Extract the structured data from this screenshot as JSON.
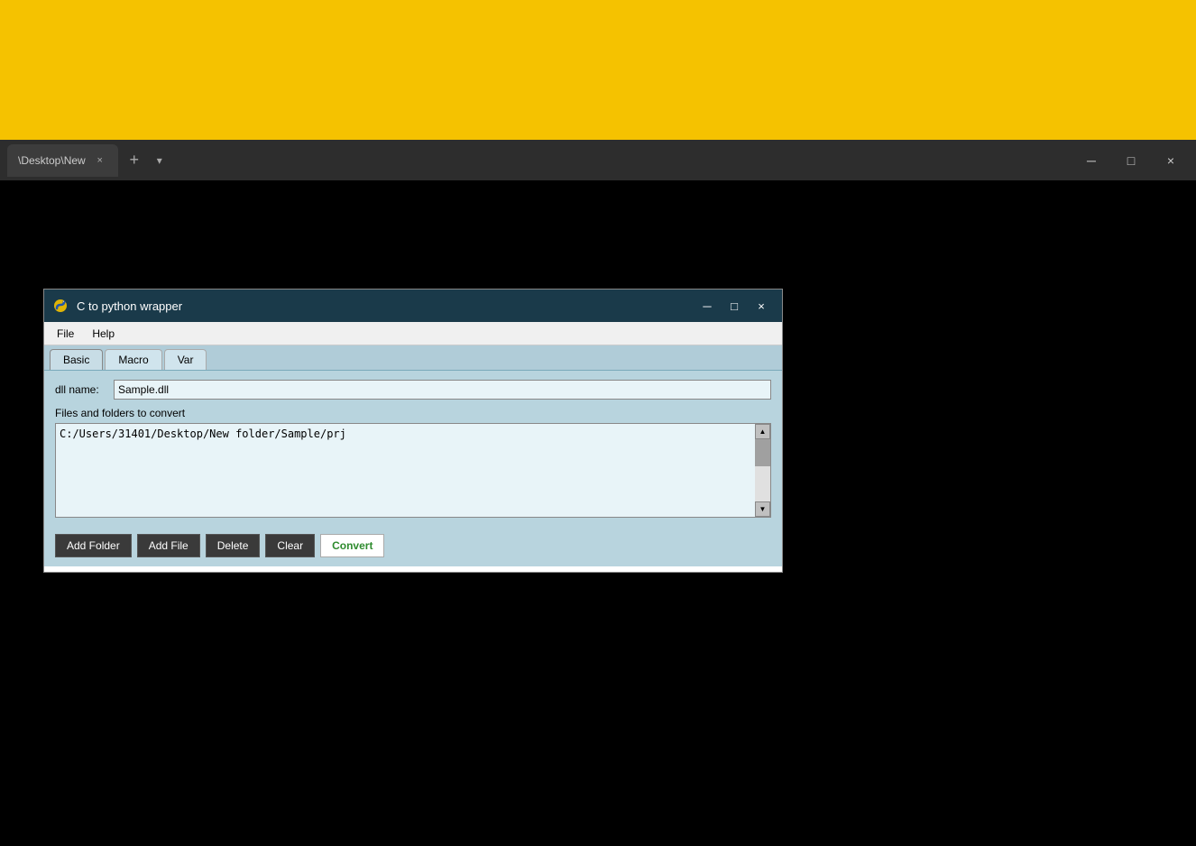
{
  "topbar": {
    "background_color": "#F5C200"
  },
  "browser_chrome": {
    "tab_label": "\\Desktop\\New",
    "tab_close_symbol": "×",
    "new_tab_symbol": "+",
    "dropdown_symbol": "▾",
    "minimize_symbol": "─",
    "maximize_symbol": "□",
    "close_symbol": "×"
  },
  "app_window": {
    "title": "C to python wrapper",
    "title_minimize": "─",
    "title_maximize": "□",
    "title_close": "×",
    "menu": {
      "file_label": "File",
      "help_label": "Help"
    },
    "tabs": [
      {
        "label": "Basic",
        "active": true
      },
      {
        "label": "Macro",
        "active": false
      },
      {
        "label": "Var",
        "active": false
      }
    ],
    "form": {
      "dll_name_label": "dll name:",
      "dll_name_value": "Sample.dll",
      "files_label": "Files and folders to convert",
      "files_value": "C:/Users/31401/Desktop/New folder/Sample/prj"
    },
    "buttons": {
      "add_folder": "Add Folder",
      "add_file": "Add File",
      "delete": "Delete",
      "clear": "Clear",
      "convert": "Convert"
    }
  }
}
